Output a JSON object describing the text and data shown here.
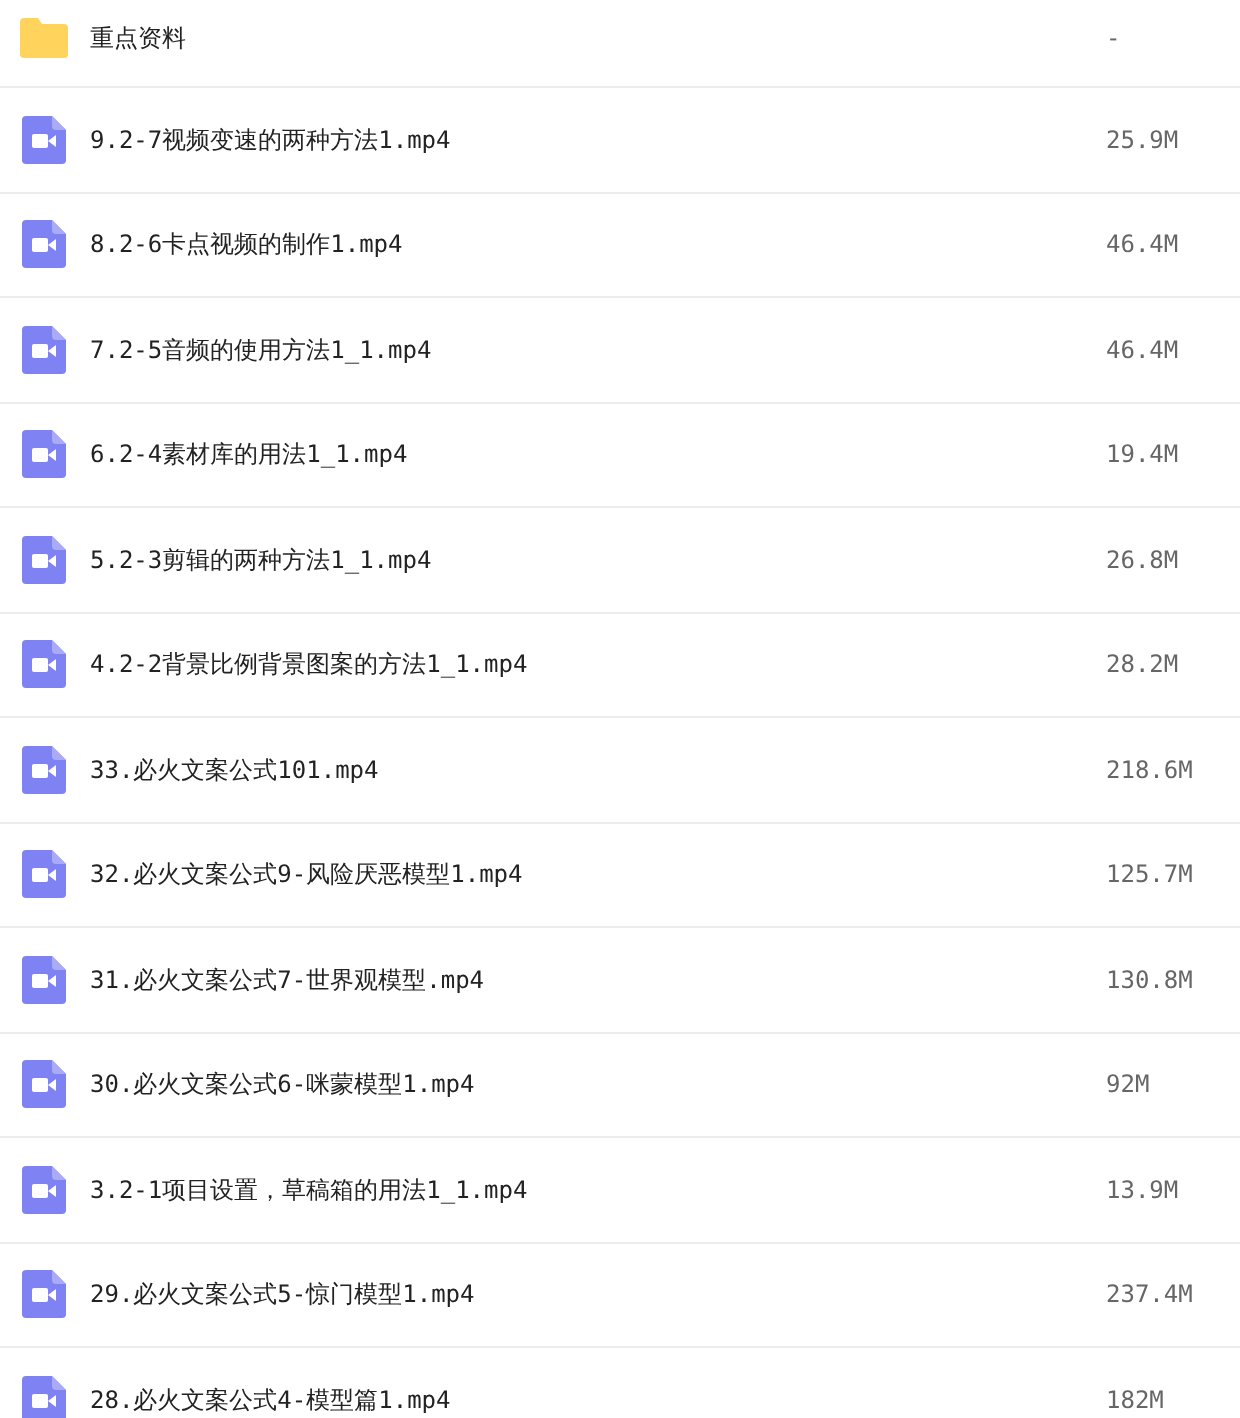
{
  "files": [
    {
      "kind": "folder",
      "name": "重点资料",
      "size": "-"
    },
    {
      "kind": "video",
      "name": "9.2-7视频变速的两种方法1.mp4",
      "size": "25.9M"
    },
    {
      "kind": "video",
      "name": "8.2-6卡点视频的制作1.mp4",
      "size": "46.4M"
    },
    {
      "kind": "video",
      "name": "7.2-5音频的使用方法1_1.mp4",
      "size": "46.4M"
    },
    {
      "kind": "video",
      "name": "6.2-4素材库的用法1_1.mp4",
      "size": "19.4M"
    },
    {
      "kind": "video",
      "name": "5.2-3剪辑的两种方法1_1.mp4",
      "size": "26.8M"
    },
    {
      "kind": "video",
      "name": "4.2-2背景比例背景图案的方法1_1.mp4",
      "size": "28.2M"
    },
    {
      "kind": "video",
      "name": "33.必火文案公式101.mp4",
      "size": "218.6M"
    },
    {
      "kind": "video",
      "name": "32.必火文案公式9-风险厌恶模型1.mp4",
      "size": "125.7M"
    },
    {
      "kind": "video",
      "name": "31.必火文案公式7-世界观模型.mp4",
      "size": "130.8M"
    },
    {
      "kind": "video",
      "name": "30.必火文案公式6-咪蒙模型1.mp4",
      "size": "92M"
    },
    {
      "kind": "video",
      "name": "3.2-1项目设置，草稿箱的用法1_1.mp4",
      "size": "13.9M"
    },
    {
      "kind": "video",
      "name": "29.必火文案公式5-惊门模型1.mp4",
      "size": "237.4M"
    },
    {
      "kind": "video",
      "name": "28.必火文案公式4-模型篇1.mp4",
      "size": "182M"
    }
  ]
}
